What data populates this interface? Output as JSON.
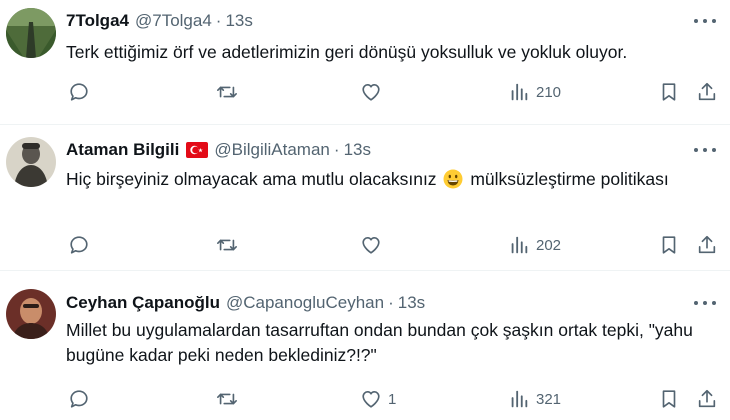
{
  "tweets": [
    {
      "name": "7Tolga4",
      "handle": "@7Tolga4",
      "separator": "·",
      "time": "13s",
      "has_flag": false,
      "text": "Terk ettiğimiz örf ve adetlerimizin geri dönüşü yoksulluk ve yokluk oluyor.",
      "text_after_emoji": "",
      "replies": "",
      "retweets": "",
      "likes": "",
      "views": "210"
    },
    {
      "name": "Ataman Bilgili",
      "handle": "@BilgiliAtaman",
      "separator": "·",
      "time": "13s",
      "has_flag": true,
      "text": "Hiç birşeyiniz olmayacak ama mutlu olacaksınız",
      "text_after_emoji": "mülksüzleştirme politikası",
      "replies": "",
      "retweets": "",
      "likes": "",
      "views": "202"
    },
    {
      "name": "Ceyhan Çapanoğlu",
      "handle": "@CapanogluCeyhan",
      "separator": "·",
      "time": "13s",
      "has_flag": false,
      "text": "Millet bu uygulamalardan tasarruftan ondan bundan çok şaşkın ortak tepki, \"yahu bugüne kadar peki neden beklediniz?!?\"",
      "text_after_emoji": "",
      "replies": "",
      "retweets": "",
      "likes": "1",
      "views": "321"
    }
  ],
  "icons": {
    "reply": "reply-icon",
    "retweet": "retweet-icon",
    "like": "heart-icon",
    "views": "views-icon",
    "bookmark": "bookmark-icon",
    "share": "share-icon",
    "more": "more-icon",
    "flag": "turkey-flag-icon",
    "emoji": "grinning-face-emoji"
  },
  "colors": {
    "text": "#0f1419",
    "secondary": "#536471",
    "divider": "#eff3f4",
    "flag_red": "#e30a17"
  }
}
